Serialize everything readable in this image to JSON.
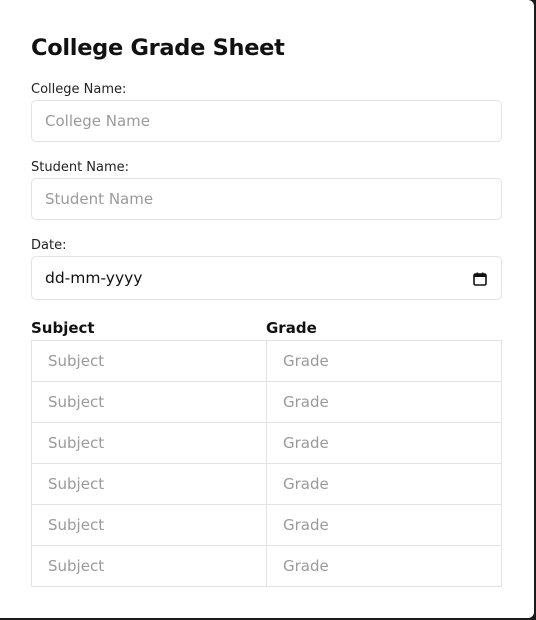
{
  "form": {
    "title": "College Grade Sheet",
    "college": {
      "label": "College Name:",
      "placeholder": "College Name",
      "value": ""
    },
    "student": {
      "label": "Student Name:",
      "placeholder": "Student Name",
      "value": ""
    },
    "date": {
      "label": "Date:",
      "value": "dd-mm-yyyy",
      "icon": "calendar-icon"
    }
  },
  "table": {
    "headers": [
      "Subject",
      "Grade"
    ],
    "rows": [
      {
        "subject_placeholder": "Subject",
        "grade_placeholder": "Grade"
      },
      {
        "subject_placeholder": "Subject",
        "grade_placeholder": "Grade"
      },
      {
        "subject_placeholder": "Subject",
        "grade_placeholder": "Grade"
      },
      {
        "subject_placeholder": "Subject",
        "grade_placeholder": "Grade"
      },
      {
        "subject_placeholder": "Subject",
        "grade_placeholder": "Grade"
      },
      {
        "subject_placeholder": "Subject",
        "grade_placeholder": "Grade"
      }
    ]
  },
  "colors": {
    "card_background": "#ffffff",
    "page_background": "#1a1a1a",
    "border": "#e3e3e3",
    "placeholder": "#9a9a9a",
    "text": "#111111"
  }
}
